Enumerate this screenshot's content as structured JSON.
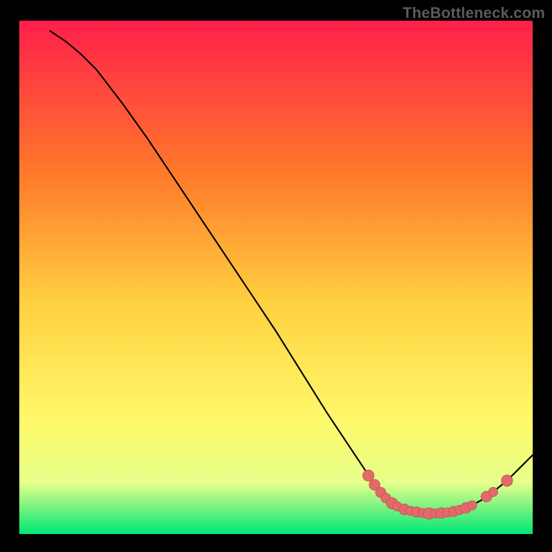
{
  "watermark": "TheBottleneck.com",
  "colors": {
    "bg_black": "#000000",
    "gradient_top": "#ff1f4b",
    "gradient_mid1": "#ff7a2a",
    "gradient_mid2": "#ffd140",
    "gradient_mid3": "#fff96b",
    "gradient_mid4": "#e6ff8a",
    "gradient_bot": "#00e676",
    "curve": "#000000",
    "dot_fill": "#e26a6a",
    "dot_stroke": "#c94f4f"
  },
  "chart_data": {
    "type": "line",
    "title": "",
    "xlabel": "",
    "ylabel": "",
    "xlim": [
      0,
      100
    ],
    "ylim": [
      0,
      100
    ],
    "curve": [
      [
        6,
        98
      ],
      [
        9,
        96
      ],
      [
        12,
        93.5
      ],
      [
        15,
        90.5
      ],
      [
        20,
        84
      ],
      [
        25,
        77
      ],
      [
        30,
        69.5
      ],
      [
        35,
        62
      ],
      [
        40,
        54.5
      ],
      [
        45,
        47
      ],
      [
        50,
        39.5
      ],
      [
        55,
        31.5
      ],
      [
        60,
        23.5
      ],
      [
        65,
        16
      ],
      [
        68,
        11.5
      ],
      [
        70,
        9
      ],
      [
        72,
        7
      ],
      [
        74,
        5.5
      ],
      [
        76,
        4.7
      ],
      [
        78,
        4.2
      ],
      [
        80,
        4
      ],
      [
        82,
        4
      ],
      [
        84,
        4.2
      ],
      [
        86,
        4.7
      ],
      [
        88,
        5.5
      ],
      [
        90,
        6.6
      ],
      [
        92,
        8
      ],
      [
        94,
        9.6
      ],
      [
        96,
        11.4
      ],
      [
        98,
        13.4
      ],
      [
        100,
        15.4
      ]
    ],
    "dots": [
      {
        "x": 68.0,
        "y": 11.4,
        "r": 1.4
      },
      {
        "x": 69.2,
        "y": 9.6,
        "r": 1.3
      },
      {
        "x": 70.4,
        "y": 8.1,
        "r": 1.2
      },
      {
        "x": 71.4,
        "y": 7.0,
        "r": 1.1
      },
      {
        "x": 72.6,
        "y": 6.0,
        "r": 1.4
      },
      {
        "x": 73.6,
        "y": 5.4,
        "r": 1.0
      },
      {
        "x": 75.0,
        "y": 4.8,
        "r": 1.3
      },
      {
        "x": 76.2,
        "y": 4.5,
        "r": 1.0
      },
      {
        "x": 77.4,
        "y": 4.3,
        "r": 1.2
      },
      {
        "x": 78.6,
        "y": 4.1,
        "r": 1.0
      },
      {
        "x": 79.8,
        "y": 4.0,
        "r": 1.4
      },
      {
        "x": 81.0,
        "y": 4.0,
        "r": 1.0
      },
      {
        "x": 82.2,
        "y": 4.1,
        "r": 1.3
      },
      {
        "x": 83.4,
        "y": 4.2,
        "r": 1.0
      },
      {
        "x": 84.6,
        "y": 4.4,
        "r": 1.2
      },
      {
        "x": 85.8,
        "y": 4.7,
        "r": 1.0
      },
      {
        "x": 87.0,
        "y": 5.1,
        "r": 1.3
      },
      {
        "x": 88.2,
        "y": 5.6,
        "r": 1.0
      },
      {
        "x": 91.0,
        "y": 7.3,
        "r": 1.3
      },
      {
        "x": 92.3,
        "y": 8.2,
        "r": 1.0
      },
      {
        "x": 95.0,
        "y": 10.4,
        "r": 1.4
      }
    ]
  }
}
